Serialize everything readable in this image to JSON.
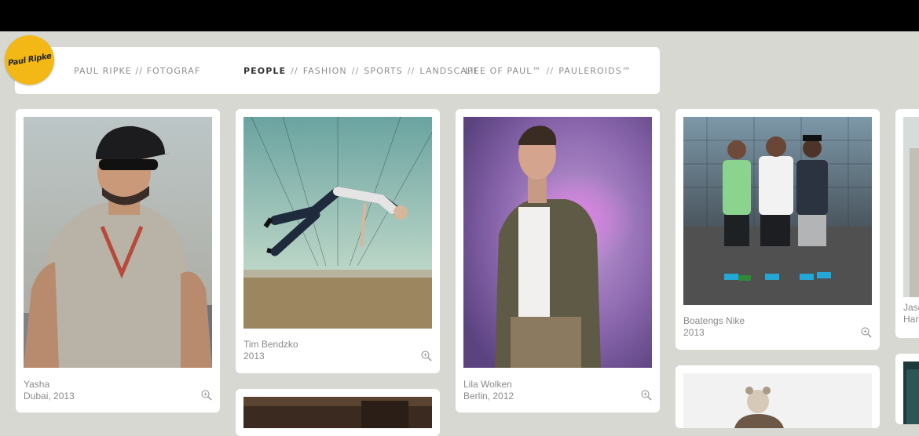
{
  "brand": {
    "logo_text": "Paul Ripke",
    "logo_color": "#f3b716"
  },
  "nav": {
    "site_title": "PAUL RIPKE // FOTOGRAF",
    "categories": [
      "PEOPLE",
      "FASHION",
      "SPORTS",
      "LANDSCAPE"
    ],
    "active": "PEOPLE",
    "extras": [
      "LIFE OF PAUL™",
      "PAULEROIDS™"
    ],
    "separator": "//"
  },
  "gallery": [
    {
      "title": "Yasha",
      "subtitle": "Dubai, 2013",
      "icon": "zoom-plus-icon"
    },
    {
      "title": "Tim Bendzko",
      "subtitle": "2013",
      "icon": "zoom-plus-icon"
    },
    {
      "title": "Lila Wolken",
      "subtitle": "Berlin, 2012",
      "icon": "zoom-plus-icon"
    },
    {
      "title": "Boatengs Nike",
      "subtitle": "2013",
      "icon": "zoom-plus-icon"
    },
    {
      "title": "Jase",
      "subtitle": "Han",
      "icon": "zoom-plus-icon"
    }
  ]
}
